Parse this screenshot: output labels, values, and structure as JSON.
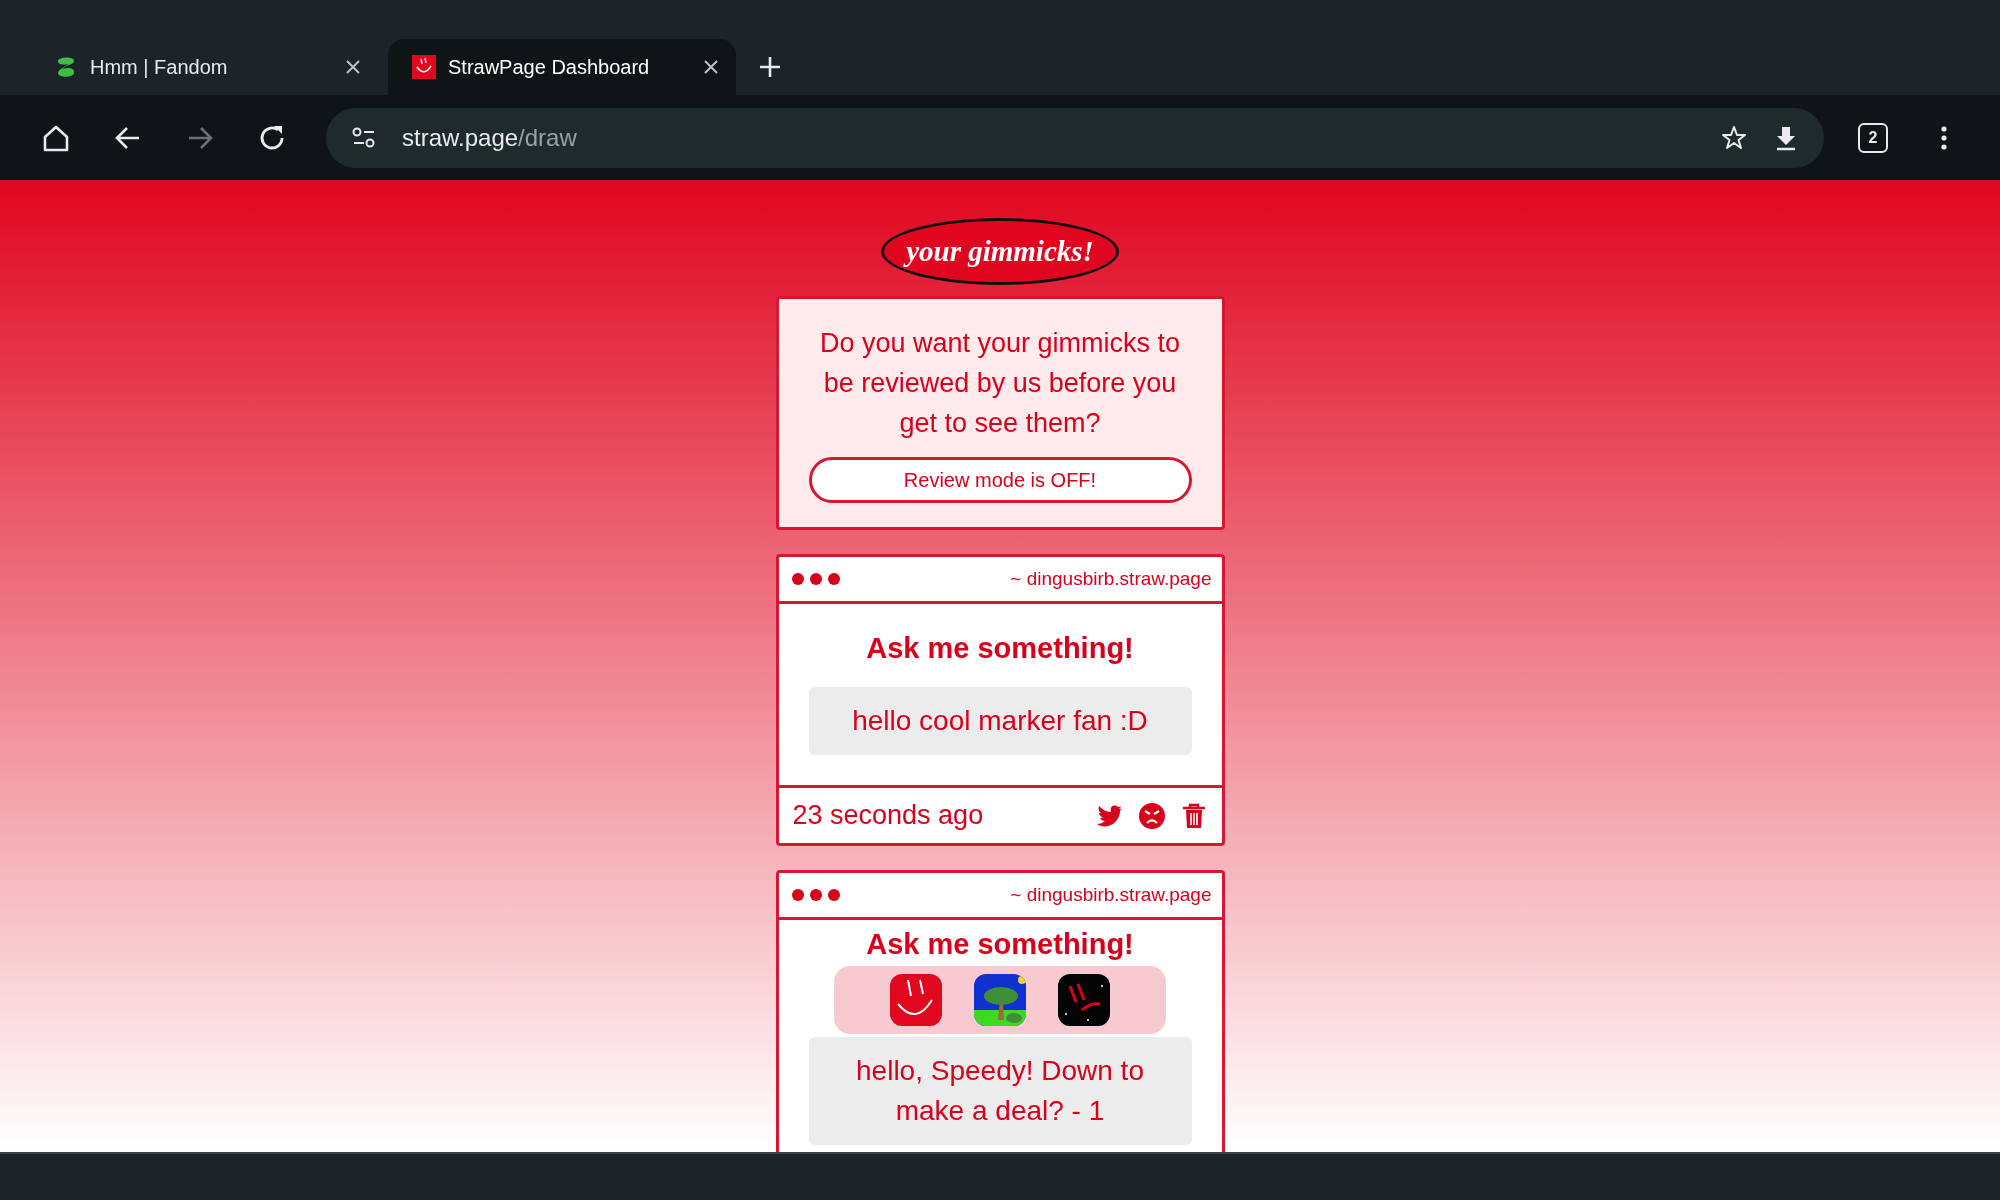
{
  "tabs": [
    {
      "title": "Hmm | Fandom",
      "selected": false,
      "kind": "fandom"
    },
    {
      "title": "StrawPage Dashboard",
      "selected": true,
      "kind": "strawpage"
    }
  ],
  "address_bar": {
    "host": "straw.page",
    "path": "/draw"
  },
  "tab_count": "2",
  "heading": "your gimmicks!",
  "review": {
    "question": "Do you want your gimmicks to be reviewed by us before you get to see them?",
    "button": "Review mode is OFF!"
  },
  "gimmicks": [
    {
      "site": "~ dingusbirb.straw.page",
      "title": "Ask me something!",
      "message": "hello cool marker fan :D",
      "time": "23 seconds ago"
    },
    {
      "site": "~ dingusbirb.straw.page",
      "title": "Ask me something!",
      "message": "hello, Speedy! Down to make a deal? - 1"
    }
  ]
}
